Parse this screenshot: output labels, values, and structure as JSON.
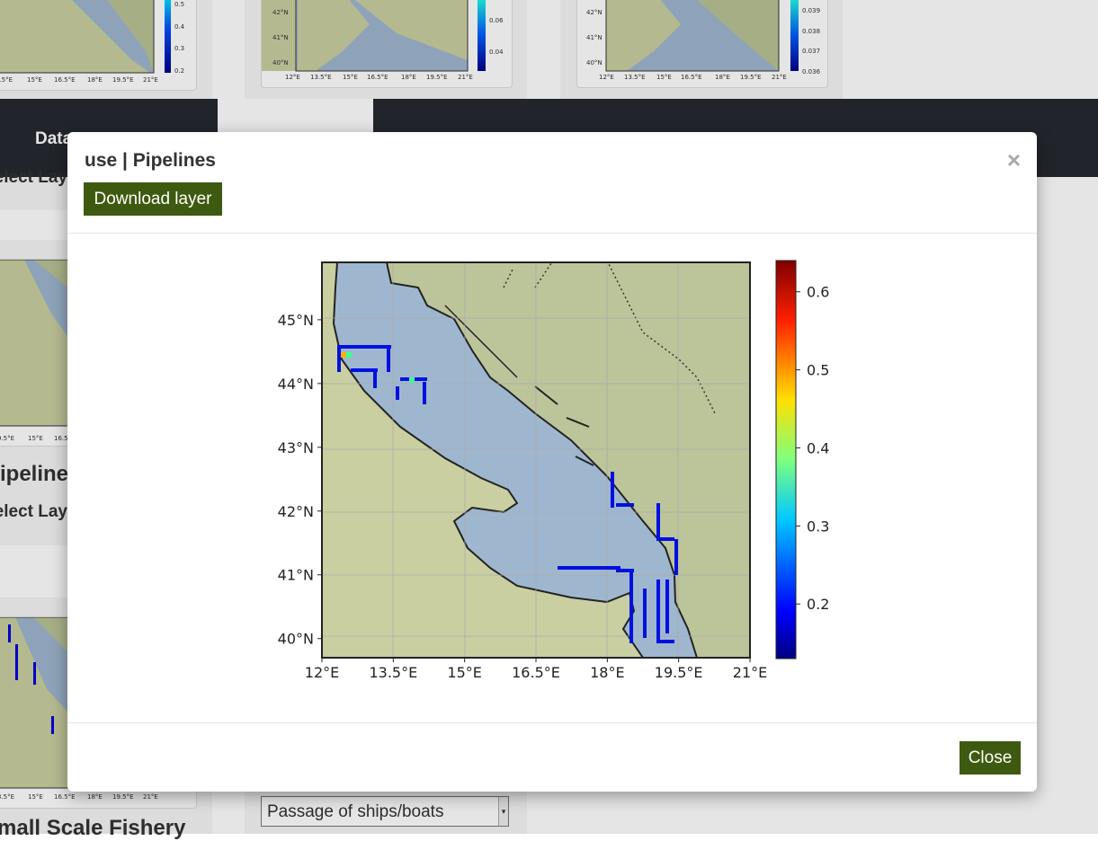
{
  "background": {
    "header_title": "Data",
    "cards": [
      {
        "title": "Pipelines",
        "subtitle": "Select Layer"
      },
      {
        "title": "Small Scale Fishery",
        "subtitle": ""
      }
    ],
    "first_card_subtitle": "Select Layer",
    "select_value": "Passage of ships/boats",
    "thumb_lat_labels": [
      "42°N",
      "41°N",
      "40°N"
    ],
    "thumb_lon_labels": [
      "12°E",
      "13.5°E",
      "15°E",
      "16.5°E",
      "18°E",
      "19.5°E",
      "21°E"
    ],
    "thumb_cbar_1": [
      "0.5",
      "0.4",
      "0.3",
      "0.2"
    ],
    "thumb_cbar_2": [
      "0.06",
      "0.04"
    ],
    "thumb_cbar_3": [
      "0.039",
      "0.038",
      "0.037",
      "0.036"
    ]
  },
  "modal": {
    "title": "use | Pipelines",
    "download_label": "Download layer",
    "close_label": "Close",
    "close_icon": "×"
  },
  "chart_data": {
    "type": "heatmap",
    "title": "",
    "xlabel": "",
    "ylabel": "",
    "x_ticks": [
      "12°E",
      "13.5°E",
      "15°E",
      "16.5°E",
      "18°E",
      "19.5°E",
      "21°E"
    ],
    "y_ticks": [
      "45°N",
      "44°N",
      "43°N",
      "42°N",
      "41°N",
      "40°N"
    ],
    "xlim": [
      12,
      21
    ],
    "ylim": [
      39.7,
      45.9
    ],
    "colorbar_ticks": [
      "0.6",
      "0.5",
      "0.4",
      "0.3",
      "0.2"
    ],
    "colorbar_range": [
      0.13,
      0.64
    ],
    "colormap": "jet",
    "grid": true,
    "sea_color": "#9fb6cf",
    "land_color": "#c9cfa0"
  }
}
